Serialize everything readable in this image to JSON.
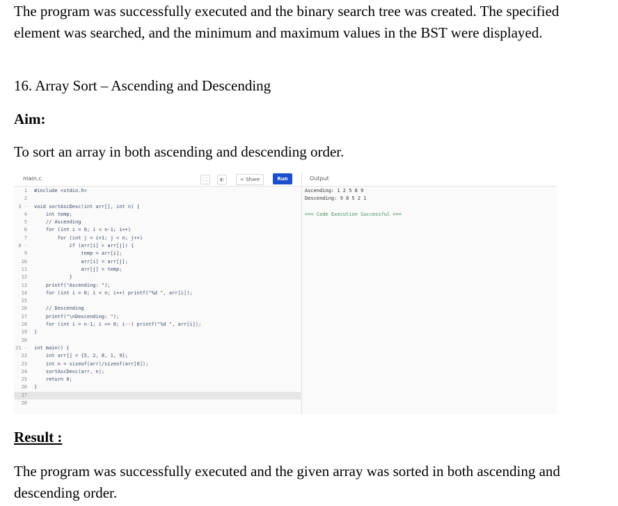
{
  "intro_paragraph": "The program was successfully executed and the binary search tree was created. The specified element was searched, and the minimum and maximum values in the BST were displayed.",
  "section_title": "16. Array Sort – Ascending and Descending",
  "aim_heading": "Aim:",
  "aim_text": "To sort an array in both ascending and descending order.",
  "ide": {
    "filename": "main.c",
    "share_label": "Share",
    "run_label": "Run",
    "output_title": "Output",
    "icons": [
      "expand-icon",
      "theme-icon",
      "share-icon"
    ],
    "code_lines": [
      {
        "n": "1",
        "text": "#include <stdio.h>"
      },
      {
        "n": "2",
        "text": ""
      },
      {
        "n": "3 -",
        "text": "void sortAscDesc(int arr[], int n) {"
      },
      {
        "n": "4",
        "text": "    int temp;"
      },
      {
        "n": "5",
        "text": "    // Ascending"
      },
      {
        "n": "6",
        "text": "    for (int i = 0; i < n-1; i++)"
      },
      {
        "n": "7",
        "text": "        for (int j = i+1; j < n; j++)"
      },
      {
        "n": "8 -",
        "text": "            if (arr[i] > arr[j]) {"
      },
      {
        "n": "9",
        "text": "                temp = arr[i];"
      },
      {
        "n": "10",
        "text": "                arr[i] = arr[j];"
      },
      {
        "n": "11",
        "text": "                arr[j] = temp;"
      },
      {
        "n": "12",
        "text": "            }"
      },
      {
        "n": "13",
        "text": "    printf(\"Ascending: \");"
      },
      {
        "n": "14",
        "text": "    for (int i = 0; i < n; i++) printf(\"%d \", arr[i]);"
      },
      {
        "n": "15",
        "text": ""
      },
      {
        "n": "16",
        "text": "    // Descending"
      },
      {
        "n": "17",
        "text": "    printf(\"\\nDescending: \");"
      },
      {
        "n": "18",
        "text": "    for (int i = n-1; i >= 0; i--) printf(\"%d \", arr[i]);"
      },
      {
        "n": "19",
        "text": "}"
      },
      {
        "n": "20",
        "text": ""
      },
      {
        "n": "21 -",
        "text": "int main() {"
      },
      {
        "n": "22",
        "text": "    int arr[] = {5, 2, 8, 1, 9};"
      },
      {
        "n": "23",
        "text": "    int n = sizeof(arr)/sizeof(arr[0]);"
      },
      {
        "n": "24",
        "text": "    sortAscDesc(arr, n);"
      },
      {
        "n": "25",
        "text": "    return 0;"
      },
      {
        "n": "26",
        "text": "}"
      },
      {
        "n": "27",
        "text": ""
      },
      {
        "n": "28",
        "text": ""
      }
    ],
    "active_line": 27,
    "output_lines": [
      {
        "text": "Ascending: 1 2 5 8 9",
        "kind": "normal"
      },
      {
        "text": "Descending: 9 8 5 2 1",
        "kind": "normal"
      },
      {
        "text": "",
        "kind": "normal"
      },
      {
        "text": "=== Code Execution Successful ===",
        "kind": "success"
      }
    ]
  },
  "result_heading": "Result :",
  "result_text": "The program was successfully executed and the given array was sorted in both ascending and descending order."
}
